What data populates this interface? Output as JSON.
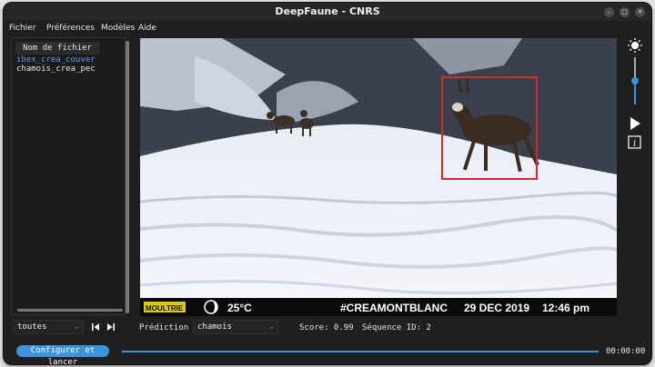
{
  "window": {
    "title": "DeepFaune - CNRS"
  },
  "menubar": {
    "items": [
      "Fichier",
      "Préférences",
      "Modèles",
      "Aide"
    ]
  },
  "filelist": {
    "header": "Nom de fichier",
    "items": [
      {
        "name": "ibex_crea_couver",
        "selected": true
      },
      {
        "name": "chamois_crea_pec",
        "selected": false
      }
    ]
  },
  "image_overlay": {
    "brand": "MOULTRIE",
    "temperature": "25°C",
    "tag": "#CREAMONTBLANC",
    "date": "29 DEC 2019",
    "time": "12:46 pm"
  },
  "controls": {
    "filter_value": "toutes",
    "prediction_label": "Prédiction",
    "prediction_value": "chamois",
    "score": "Score: 0.99",
    "sequence": "Séquence ID: 2"
  },
  "bottom": {
    "run_label": "Configurer et lancer",
    "timer": "00:00:00"
  },
  "colors": {
    "accent": "#3a94e0",
    "bbox": "#e0242a",
    "overlay_brand": "#d9c91a"
  }
}
